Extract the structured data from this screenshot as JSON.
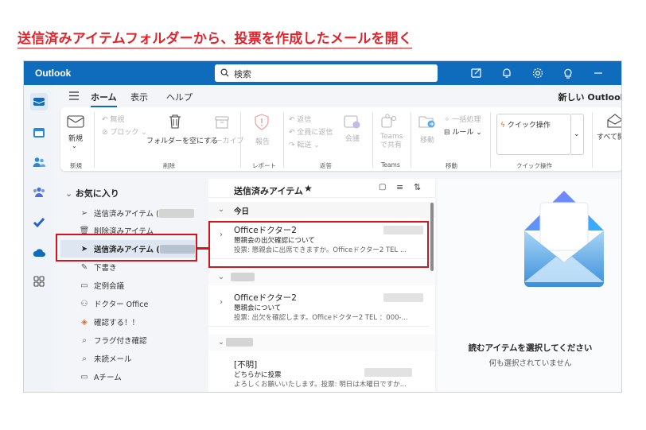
{
  "caption": "送信済みアイテムフォルダーから、投票を作成したメールを開く",
  "app": {
    "name": "Outlook",
    "search_placeholder": "検索"
  },
  "ribbon_tabs": [
    "ホーム",
    "表示",
    "ヘルプ"
  ],
  "new_outlook_label": "新しい Outlook",
  "ribbon": {
    "new_label": "新規",
    "ignore_label": "無視",
    "block_label": "ブロック",
    "empty_folder_label": "フォルダーを空にする",
    "archive_label": "アーカイブ",
    "report_label": "報告",
    "reply_label": "返信",
    "reply_all_label": "全員に返信",
    "forward_label": "転送",
    "meeting_label": "会議",
    "teams_share_label": "Teams で共有",
    "move_label": "移動",
    "move_all_label": "一括処理",
    "rules_label": "ルール",
    "quick_steps_label": "クイック操作",
    "open_all_label": "すべて開封済",
    "groups": {
      "new": "新規",
      "delete": "削除",
      "report": "レポート",
      "respond": "返答",
      "teams": "Teams",
      "move": "移動",
      "quick": "クイック操作"
    }
  },
  "folders": {
    "favorites_label": "お気に入り",
    "items": [
      {
        "label": "送信済みアイテム (",
        "icon": "send-icon"
      },
      {
        "label": "削除済みアイテム",
        "icon": "trash-icon"
      },
      {
        "label": "送信済みアイテム (",
        "icon": "send-icon"
      },
      {
        "label": "下書き",
        "icon": "draft-icon"
      },
      {
        "label": "定例会議",
        "icon": "folder-icon"
      },
      {
        "label": "ドクター Office",
        "icon": "person-icon"
      },
      {
        "label": "確認する！！",
        "icon": "tag-icon"
      },
      {
        "label": "フラグ付き確認",
        "icon": "search-folder-icon"
      },
      {
        "label": "未読メール",
        "icon": "search-folder-icon"
      },
      {
        "label": "Aチーム",
        "icon": "folder-icon"
      }
    ]
  },
  "message_list": {
    "title": "送信済みアイテム",
    "groups": {
      "today": "今日"
    },
    "messages": [
      {
        "sender": "Officeドクター2",
        "subject": "懇親会の出欠確認について",
        "preview": "投票: 懇親会に出席できますか。Officeドクター2 TEL ..."
      },
      {
        "sender": "Officeドクター2",
        "subject": "懇親会について",
        "preview": "投票: 出欠を確認します。Officeドクター2 TEL ：000-..."
      },
      {
        "sender": "[不明]",
        "subject": "どちらかに投票",
        "preview": "よろしくお願いいたします。投票: 明日は木曜日ですか..."
      }
    ]
  },
  "reading_pane": {
    "title": "読むアイテムを選択してください",
    "subtitle": "何も選択されていません"
  },
  "colors": {
    "brand": "#0f6cbd",
    "highlight": "#d0171f"
  }
}
